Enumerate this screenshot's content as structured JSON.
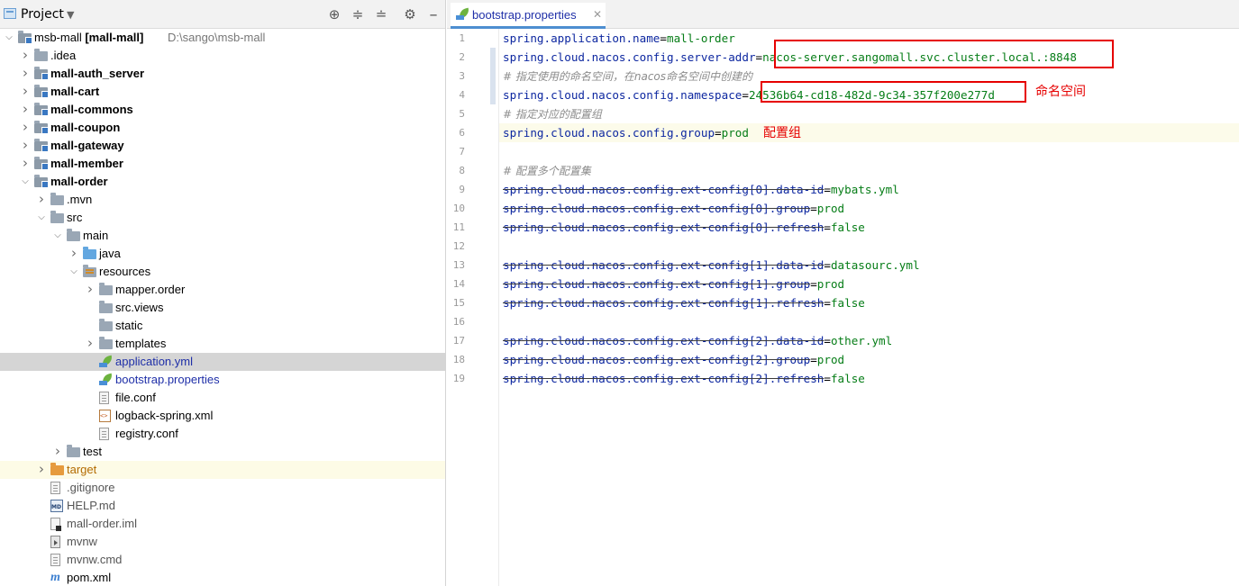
{
  "project_panel": {
    "title": "Project",
    "tree": [
      {
        "label": "msb-mall [mall-mall]",
        "hint": "D:\\sango\\msb-mall",
        "depth": 0,
        "expanded": true,
        "icon": "module-folder-icon",
        "style": "bold-name"
      },
      {
        "label": ".idea",
        "depth": 1,
        "expanded": false,
        "icon": "folder-icon"
      },
      {
        "label": "mall-auth_server",
        "depth": 1,
        "expanded": false,
        "icon": "module-folder-icon",
        "style": "bold"
      },
      {
        "label": "mall-cart",
        "depth": 1,
        "expanded": false,
        "icon": "module-folder-icon",
        "style": "bold"
      },
      {
        "label": "mall-commons",
        "depth": 1,
        "expanded": false,
        "icon": "module-folder-icon",
        "style": "bold"
      },
      {
        "label": "mall-coupon",
        "depth": 1,
        "expanded": false,
        "icon": "module-folder-icon",
        "style": "bold"
      },
      {
        "label": "mall-gateway",
        "depth": 1,
        "expanded": false,
        "icon": "module-folder-icon",
        "style": "bold"
      },
      {
        "label": "mall-member",
        "depth": 1,
        "expanded": false,
        "icon": "module-folder-icon",
        "style": "bold"
      },
      {
        "label": "mall-order",
        "depth": 1,
        "expanded": true,
        "icon": "module-folder-icon",
        "style": "bold"
      },
      {
        "label": ".mvn",
        "depth": 2,
        "expanded": false,
        "icon": "folder-icon"
      },
      {
        "label": "src",
        "depth": 2,
        "expanded": true,
        "icon": "folder-icon"
      },
      {
        "label": "main",
        "depth": 3,
        "expanded": true,
        "icon": "folder-icon"
      },
      {
        "label": "java",
        "depth": 4,
        "expanded": false,
        "icon": "source-folder-icon"
      },
      {
        "label": "resources",
        "depth": 4,
        "expanded": true,
        "icon": "resources-folder-icon"
      },
      {
        "label": "mapper.order",
        "depth": 5,
        "expanded": false,
        "icon": "folder-icon"
      },
      {
        "label": "src.views",
        "depth": 5,
        "icon": "folder-icon"
      },
      {
        "label": "static",
        "depth": 5,
        "icon": "folder-icon"
      },
      {
        "label": "templates",
        "depth": 5,
        "expanded": false,
        "icon": "folder-icon"
      },
      {
        "label": "application.yml",
        "depth": 5,
        "icon": "spring-leaf-icon",
        "style": "blue",
        "selected": true
      },
      {
        "label": "bootstrap.properties",
        "depth": 5,
        "icon": "spring-leaf-icon",
        "style": "blue"
      },
      {
        "label": "file.conf",
        "depth": 5,
        "icon": "text-file-icon"
      },
      {
        "label": "logback-spring.xml",
        "depth": 5,
        "icon": "xml-file-icon"
      },
      {
        "label": "registry.conf",
        "depth": 5,
        "icon": "text-file-icon"
      },
      {
        "label": "test",
        "depth": 3,
        "expanded": false,
        "icon": "folder-icon"
      },
      {
        "label": "target",
        "depth": 2,
        "expanded": false,
        "icon": "excluded-folder-icon",
        "style": "orange",
        "highlight": true
      },
      {
        "label": ".gitignore",
        "depth": 2,
        "icon": "text-file-icon",
        "style": "gray"
      },
      {
        "label": "HELP.md",
        "depth": 2,
        "icon": "markdown-file-icon",
        "style": "gray"
      },
      {
        "label": "mall-order.iml",
        "depth": 2,
        "icon": "iml-file-icon",
        "style": "gray"
      },
      {
        "label": "mvnw",
        "depth": 2,
        "icon": "script-file-icon",
        "style": "gray"
      },
      {
        "label": "mvnw.cmd",
        "depth": 2,
        "icon": "text-file-icon",
        "style": "gray"
      },
      {
        "label": "pom.xml",
        "depth": 2,
        "icon": "maven-icon",
        "style": "black"
      }
    ]
  },
  "editor": {
    "tab_label": "bootstrap.properties",
    "current_line": 6,
    "lines": [
      {
        "n": "1",
        "segments": [
          {
            "t": "spring.application.name",
            "c": "k"
          },
          {
            "t": "=",
            "c": "eq"
          },
          {
            "t": "mall-order",
            "c": "v"
          }
        ]
      },
      {
        "n": "2",
        "segments": [
          {
            "t": "spring.cloud.nacos.config.server-addr",
            "c": "k"
          },
          {
            "t": "=",
            "c": "eq"
          },
          {
            "t": "nacos-server.sangomall.svc.cluster.local.:8848",
            "c": "v"
          }
        ]
      },
      {
        "n": "3",
        "segments": [
          {
            "t": "# 指定使用的命名空间，在nacos命名空间中创建的",
            "c": "c"
          }
        ]
      },
      {
        "n": "4",
        "segments": [
          {
            "t": "spring.cloud.nacos.config.namespace",
            "c": "k"
          },
          {
            "t": "=",
            "c": "eq"
          },
          {
            "t": "24536b64-cd18-482d-9c34-357f200e277d",
            "c": "v"
          }
        ]
      },
      {
        "n": "5",
        "segments": [
          {
            "t": "# 指定对应的配置组",
            "c": "c"
          }
        ]
      },
      {
        "n": "6",
        "segments": [
          {
            "t": "spring.cloud.nacos.config.group",
            "c": "k"
          },
          {
            "t": "=",
            "c": "eq"
          },
          {
            "t": "prod",
            "c": "v"
          }
        ]
      },
      {
        "n": "7",
        "segments": []
      },
      {
        "n": "8",
        "segments": [
          {
            "t": "# 配置多个配置集",
            "c": "c"
          }
        ]
      },
      {
        "n": "9",
        "strike": true,
        "segments": [
          {
            "t": "spring.cloud.nacos.config.ext-config[0].data-id",
            "c": "k"
          },
          {
            "t": "=",
            "c": "eq"
          },
          {
            "t": "mybats.yml",
            "c": "v"
          }
        ]
      },
      {
        "n": "10",
        "strike": true,
        "segments": [
          {
            "t": "spring.cloud.nacos.config.ext-config[0].group",
            "c": "k"
          },
          {
            "t": "=",
            "c": "eq"
          },
          {
            "t": "prod",
            "c": "v"
          }
        ]
      },
      {
        "n": "11",
        "strike": true,
        "segments": [
          {
            "t": "spring.cloud.nacos.config.ext-config[0].refresh",
            "c": "k"
          },
          {
            "t": "=",
            "c": "eq"
          },
          {
            "t": "false",
            "c": "v"
          }
        ]
      },
      {
        "n": "12",
        "segments": []
      },
      {
        "n": "13",
        "strike": true,
        "segments": [
          {
            "t": "spring.cloud.nacos.config.ext-config[1].data-id",
            "c": "k"
          },
          {
            "t": "=",
            "c": "eq"
          },
          {
            "t": "datasourc.yml",
            "c": "v"
          }
        ]
      },
      {
        "n": "14",
        "strike": true,
        "segments": [
          {
            "t": "spring.cloud.nacos.config.ext-config[1].group",
            "c": "k"
          },
          {
            "t": "=",
            "c": "eq"
          },
          {
            "t": "prod",
            "c": "v"
          }
        ]
      },
      {
        "n": "15",
        "strike": true,
        "segments": [
          {
            "t": "spring.cloud.nacos.config.ext-config[1].refresh",
            "c": "k"
          },
          {
            "t": "=",
            "c": "eq"
          },
          {
            "t": "false",
            "c": "v"
          }
        ]
      },
      {
        "n": "16",
        "segments": []
      },
      {
        "n": "17",
        "strike": true,
        "segments": [
          {
            "t": "spring.cloud.nacos.config.ext-config[2].data-id",
            "c": "k"
          },
          {
            "t": "=",
            "c": "eq"
          },
          {
            "t": "other.yml",
            "c": "v"
          }
        ]
      },
      {
        "n": "18",
        "strike": true,
        "segments": [
          {
            "t": "spring.cloud.nacos.config.ext-config[2].group",
            "c": "k"
          },
          {
            "t": "=",
            "c": "eq"
          },
          {
            "t": "prod",
            "c": "v"
          }
        ]
      },
      {
        "n": "19",
        "strike": true,
        "segments": [
          {
            "t": "spring.cloud.nacos.config.ext-config[2].refresh",
            "c": "k"
          },
          {
            "t": "=",
            "c": "eq"
          },
          {
            "t": "false",
            "c": "v"
          }
        ]
      }
    ]
  },
  "annotations": {
    "namespace_label": "命名空间",
    "group_label": "配置组"
  },
  "colors": {
    "annotation_red": "#e60000",
    "key_blue": "#0d27a0",
    "value_green": "#067d17",
    "comment_gray": "#8c8c8c",
    "selection_gray": "#d5d5d5"
  }
}
